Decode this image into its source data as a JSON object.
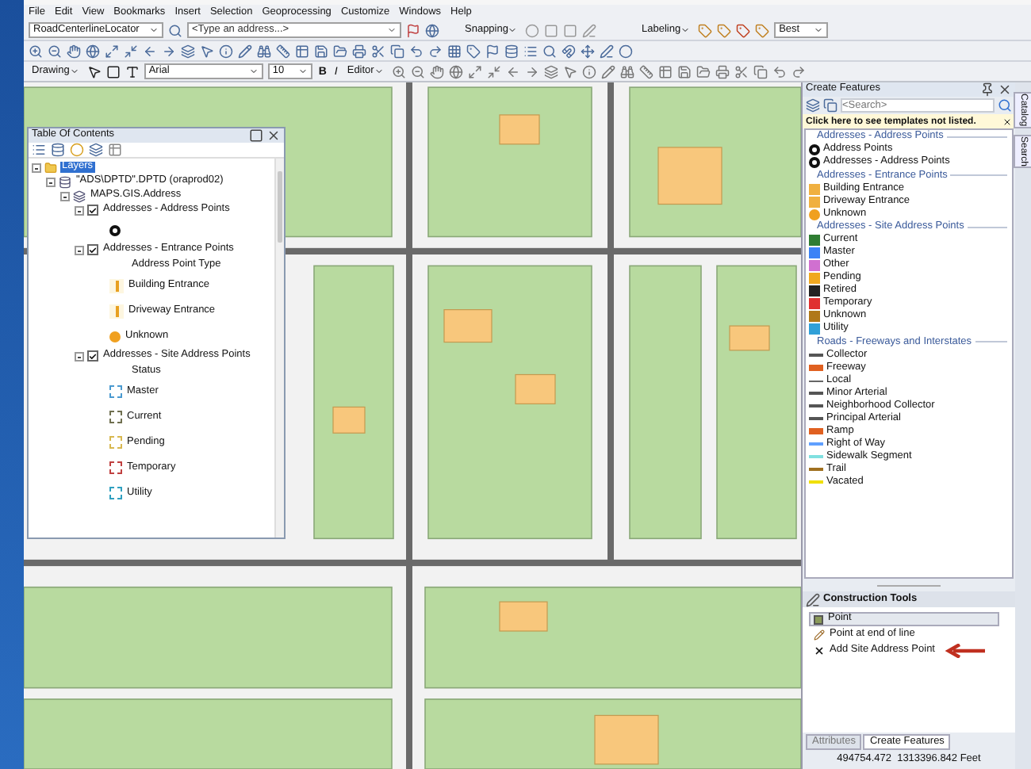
{
  "menu": [
    "File",
    "Edit",
    "View",
    "Bookmarks",
    "Insert",
    "Selection",
    "Geoprocessing",
    "Customize",
    "Windows",
    "Help"
  ],
  "toolbar": {
    "locator": "RoadCenterlineLocator",
    "address_placeholder": "<Type an address...>",
    "snapping": "Snapping",
    "labeling": "Labeling",
    "label_quality": "Best",
    "drawing": "Drawing",
    "font": "Arial",
    "font_size": "10",
    "bold": "B",
    "italic": "I",
    "editor": "Editor"
  },
  "toc": {
    "title": "Table Of Contents",
    "tree": [
      {
        "label": "Layers",
        "kind": "group",
        "expanded": true,
        "selected": true,
        "children": [
          {
            "label": "\"ADS\\DPTD\".DPTD (oraprod02)",
            "kind": "database",
            "expanded": true,
            "selected": false,
            "children": [
              {
                "label": "MAPS.GIS.Address",
                "kind": "dataset",
                "expanded": true,
                "selected": false,
                "children": [
                  {
                    "label": "Addresses - Address Points",
                    "checked": true,
                    "expanded": true,
                    "selected": false,
                    "legend": [
                      {
                        "kind": "ring",
                        "color": "#111111"
                      }
                    ]
                  },
                  {
                    "label": "Addresses - Entrance Points",
                    "checked": true,
                    "expanded": true,
                    "selected": false,
                    "legend": [
                      {
                        "kind": "heading",
                        "label": "Address Point Type"
                      },
                      {
                        "kind": "bar",
                        "label": "Building Entrance",
                        "color": "#e8a020"
                      },
                      {
                        "kind": "bar",
                        "label": "Driveway Entrance",
                        "color": "#e8a020"
                      },
                      {
                        "kind": "dot",
                        "label": "Unknown",
                        "color": "#f0a020"
                      }
                    ]
                  },
                  {
                    "label": "Addresses - Site Address Points",
                    "checked": true,
                    "expanded": true,
                    "selected": false,
                    "legend": [
                      {
                        "kind": "heading",
                        "label": "Status"
                      },
                      {
                        "kind": "dashed",
                        "label": "Master",
                        "color": "#4a9ad0"
                      },
                      {
                        "kind": "dashed",
                        "label": "Current",
                        "color": "#707050"
                      },
                      {
                        "kind": "dashed",
                        "label": "Pending",
                        "color": "#d8b850"
                      },
                      {
                        "kind": "dashed",
                        "label": "Temporary",
                        "color": "#c04040"
                      },
                      {
                        "kind": "dashed",
                        "label": "Utility",
                        "color": "#30a0c0"
                      }
                    ]
                  }
                ]
              }
            ]
          }
        ]
      }
    ]
  },
  "create_features": {
    "title": "Create Features",
    "search_placeholder": "<Search>",
    "notice": "Click here to see templates not listed.",
    "groups": [
      {
        "title": "Addresses - Address Points",
        "items": [
          {
            "label": "Address Points",
            "kind": "ring",
            "color": "#111111"
          },
          {
            "label": "Addresses - Address Points",
            "kind": "ring",
            "color": "#111111"
          }
        ]
      },
      {
        "title": "Addresses - Entrance Points",
        "items": [
          {
            "label": "Building Entrance",
            "kind": "square",
            "color": "#f0b040"
          },
          {
            "label": "Driveway Entrance",
            "kind": "square",
            "color": "#f0b040"
          },
          {
            "label": "Unknown",
            "kind": "dot",
            "color": "#f0a020"
          }
        ]
      },
      {
        "title": "Addresses - Site Address Points",
        "items": [
          {
            "label": "Current",
            "kind": "square",
            "color": "#2e7d32"
          },
          {
            "label": "Master",
            "kind": "square",
            "color": "#3b82f6"
          },
          {
            "label": "Other",
            "kind": "square",
            "color": "#d070d0"
          },
          {
            "label": "Pending",
            "kind": "square",
            "color": "#f0a820"
          },
          {
            "label": "Retired",
            "kind": "square",
            "color": "#222222"
          },
          {
            "label": "Temporary",
            "kind": "square",
            "color": "#e03030"
          },
          {
            "label": "Unknown",
            "kind": "square",
            "color": "#b07818"
          },
          {
            "label": "Utility",
            "kind": "square",
            "color": "#30a0d8"
          }
        ]
      },
      {
        "title": "Roads - Freeways and Interstates",
        "items": [
          {
            "label": "Collector",
            "kind": "line",
            "color": "#555555"
          },
          {
            "label": "Freeway",
            "kind": "thick",
            "color": "#e06020"
          },
          {
            "label": "Local",
            "kind": "thin",
            "color": "#666666"
          },
          {
            "label": "Minor Arterial",
            "kind": "line",
            "color": "#555555"
          },
          {
            "label": "Neighborhood Collector",
            "kind": "line",
            "color": "#555555"
          },
          {
            "label": "Principal Arterial",
            "kind": "line",
            "color": "#555555"
          },
          {
            "label": "Ramp",
            "kind": "thick",
            "color": "#e06020"
          },
          {
            "label": "Right of Way",
            "kind": "line",
            "color": "#60a0ff"
          },
          {
            "label": "Sidewalk Segment",
            "kind": "line",
            "color": "#80e0e0"
          },
          {
            "label": "Trail",
            "kind": "line",
            "color": "#a07020"
          },
          {
            "label": "Vacated",
            "kind": "line",
            "color": "#f0e000"
          }
        ]
      }
    ]
  },
  "construction_tools": {
    "title": "Construction Tools",
    "items": [
      {
        "label": "Point",
        "kind": "point",
        "selected": true
      },
      {
        "label": "Point at end of line",
        "kind": "end",
        "selected": false
      },
      {
        "label": "Add Site Address Point",
        "kind": "cross",
        "selected": false
      }
    ]
  },
  "panel_tabs": [
    {
      "label": "Attributes",
      "selected": false
    },
    {
      "label": "Create Features",
      "selected": true
    }
  ],
  "side_tabs": [
    "Catalog",
    "Search"
  ],
  "status": "494754.472  1313396.842 Feet"
}
